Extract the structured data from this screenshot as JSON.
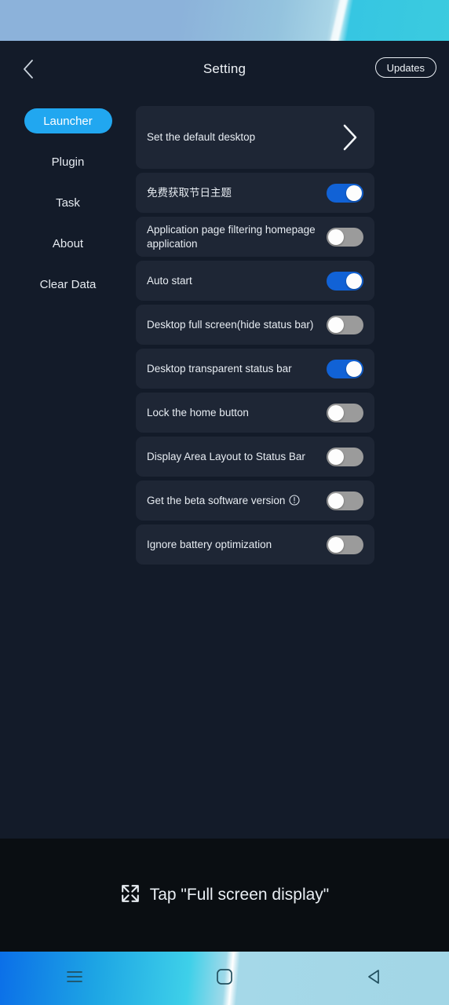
{
  "statusbar": {
    "name": "status-bar"
  },
  "header": {
    "title": "Setting",
    "back_icon": "chevron-left-icon",
    "updates_label": "Updates"
  },
  "sidebar": {
    "items": [
      {
        "label": "Launcher",
        "active": true
      },
      {
        "label": "Plugin",
        "active": false
      },
      {
        "label": "Task",
        "active": false
      },
      {
        "label": "About",
        "active": false
      },
      {
        "label": "Clear Data",
        "active": false
      }
    ]
  },
  "settings": {
    "rows": [
      {
        "label": "Set the default desktop",
        "control": "chevron",
        "tall": true
      },
      {
        "label": "免费获取节日主题",
        "control": "switch",
        "on": true
      },
      {
        "label": "Application page filtering homepage application",
        "control": "switch",
        "on": false
      },
      {
        "label": "Auto start",
        "control": "switch",
        "on": true
      },
      {
        "label": "Desktop full screen(hide status bar)",
        "control": "switch",
        "on": false
      },
      {
        "label": "Desktop transparent status bar",
        "control": "switch",
        "on": true
      },
      {
        "label": "Lock the home button",
        "control": "switch",
        "on": false
      },
      {
        "label": "Display Area Layout to Status Bar",
        "control": "switch",
        "on": false,
        "alert": true
      },
      {
        "label": "Get the beta software version",
        "control": "switch",
        "on": false,
        "alert": true
      },
      {
        "label": "Ignore battery optimization",
        "control": "switch",
        "on": false
      }
    ]
  },
  "banner": {
    "icon": "expand-fullscreen-icon",
    "text": "Tap \"Full screen display\""
  },
  "navbar": {
    "buttons": [
      {
        "icon": "menu-icon"
      },
      {
        "icon": "home-square-icon"
      },
      {
        "icon": "back-triangle-icon"
      }
    ]
  },
  "colors": {
    "accent_blue": "#21a7f0",
    "switch_on": "#1162d6",
    "switch_off": "#9b9b9b",
    "card_bg": "#1e2635",
    "page_bg": "#131b29",
    "banner_bg": "#0a0e12"
  }
}
